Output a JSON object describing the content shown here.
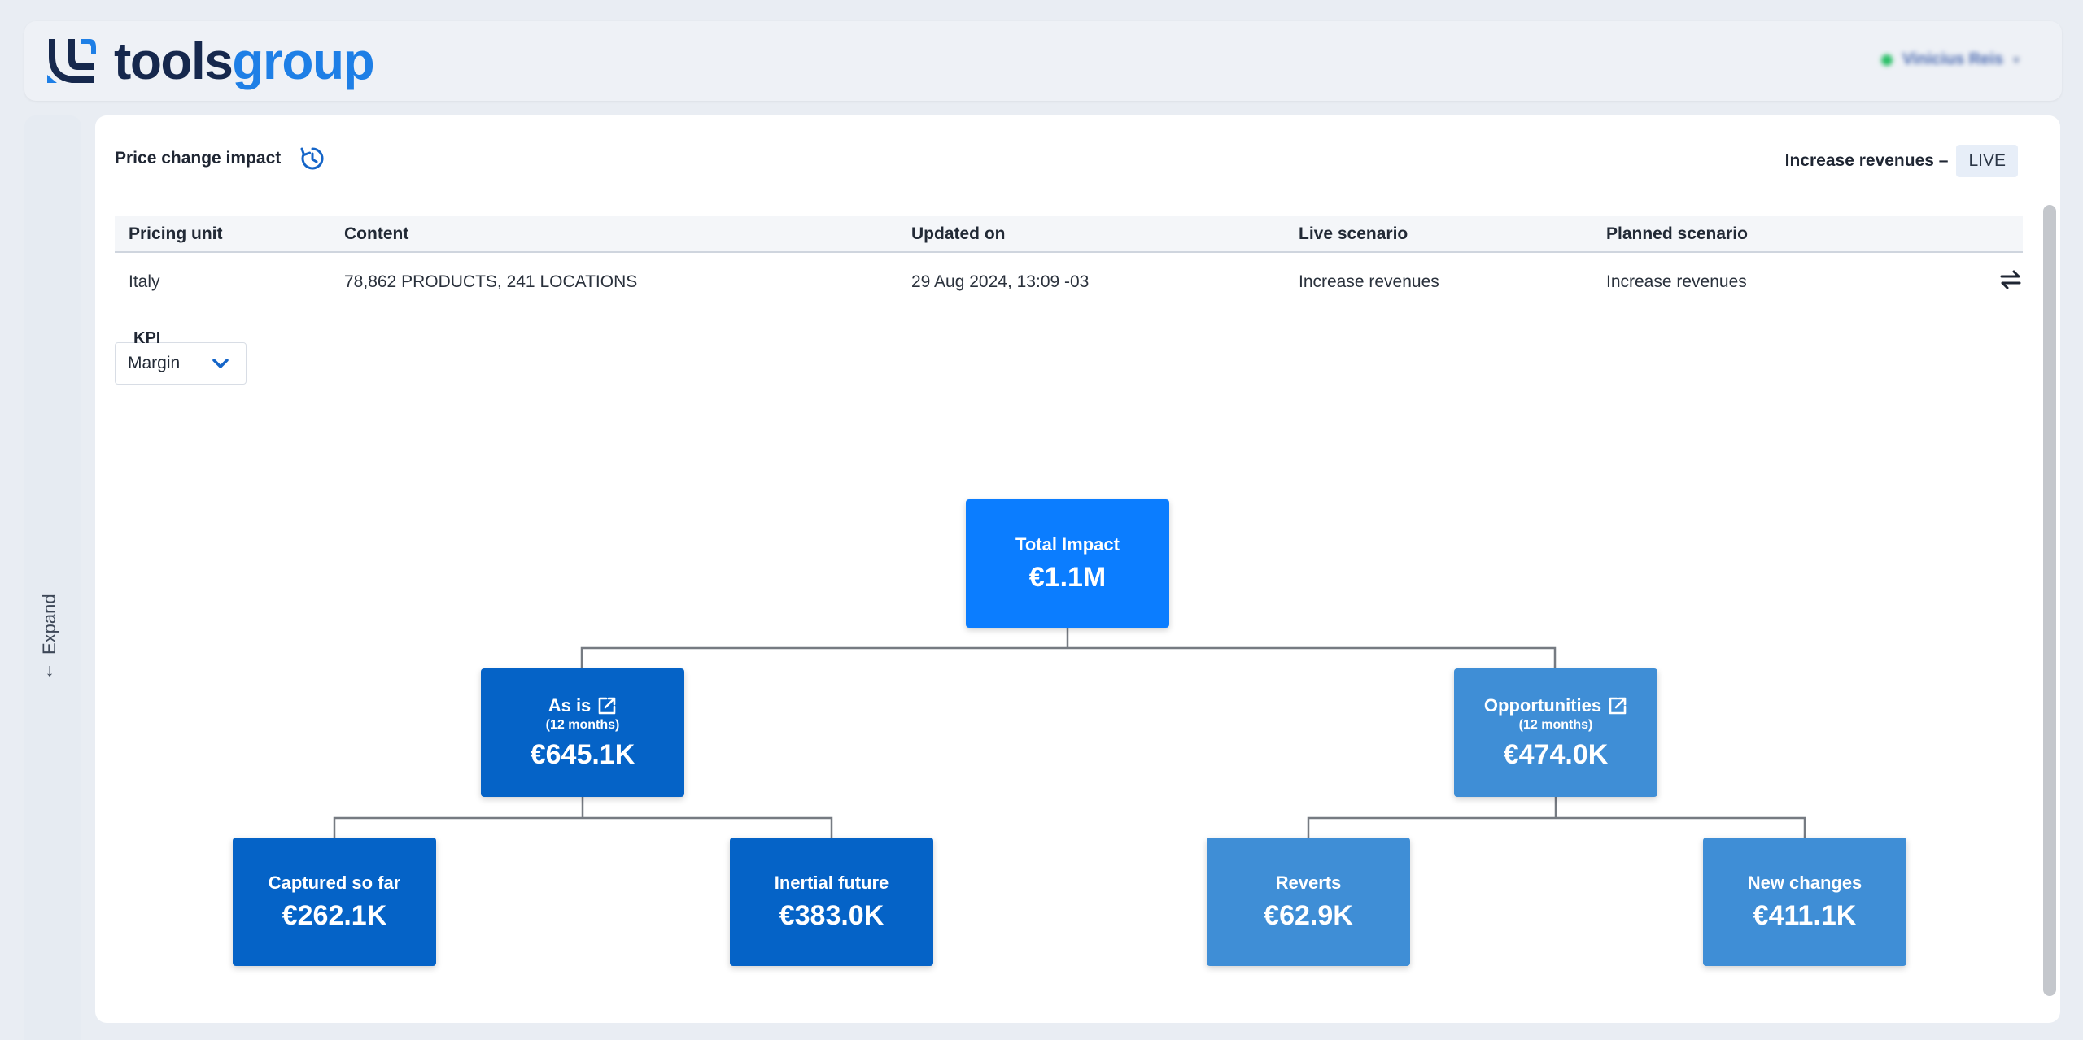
{
  "header": {
    "logo_dark": "tools",
    "logo_blue": "group",
    "user_name": "Vinicius Reis"
  },
  "sidebar": {
    "expand_label": "Expand"
  },
  "page": {
    "title": "Price change impact",
    "scenario_name": "Increase revenues –",
    "scenario_status": "LIVE"
  },
  "table": {
    "headers": [
      "Pricing unit",
      "Content",
      "Updated on",
      "Live scenario",
      "Planned scenario"
    ],
    "row": [
      "Italy",
      "78,862 PRODUCTS, 241 LOCATIONS",
      "29 Aug 2024, 13:09 -03",
      "Increase revenues",
      "Increase revenues"
    ]
  },
  "kpi": {
    "label": "KPI",
    "value": "Margin"
  },
  "tree": {
    "root": {
      "label": "Total Impact",
      "value": "€1.1M"
    },
    "as_is": {
      "label": "As is",
      "sub": "(12 months)",
      "value": "€645.1K"
    },
    "opportunities": {
      "label": "Opportunities",
      "sub": "(12 months)",
      "value": "€474.0K"
    },
    "captured": {
      "label": "Captured so far",
      "value": "€262.1K"
    },
    "inertial": {
      "label": "Inertial future",
      "value": "€383.0K"
    },
    "reverts": {
      "label": "Reverts",
      "value": "€62.9K"
    },
    "new_changes": {
      "label": "New changes",
      "value": "€411.1K"
    }
  },
  "colors": {
    "root_node": "#0b7dff",
    "as_is_branch": "#0563c7",
    "opportunities_branch": "#3f8ed6",
    "brand_blue": "#1e7fe6",
    "brand_dark": "#16284d"
  }
}
